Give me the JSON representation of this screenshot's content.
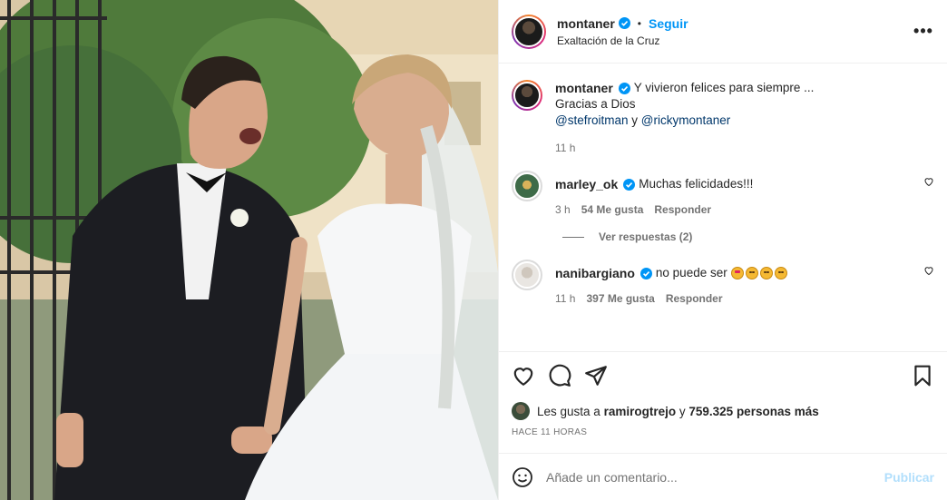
{
  "post": {
    "author": "montaner",
    "follow_label": "Seguir",
    "location": "Exaltación de la Cruz",
    "more_label": "•••"
  },
  "caption": {
    "author": "montaner",
    "line1": "Y vivieron felices para siempre ...",
    "line2": "Gracias a Dios",
    "mention1": "@stefroitman",
    "connector": "y",
    "mention2": "@rickymontaner",
    "time": "11 h"
  },
  "comments": [
    {
      "author": "marley_ok",
      "text": "Muchas felicidades!!!",
      "time": "3 h",
      "likes": "54 Me gusta",
      "reply_label": "Responder",
      "view_replies": "Ver respuestas (2)"
    },
    {
      "author": "nanibargiano",
      "text": "no puede ser",
      "emojis": [
        "smiling-face-with-heart-eyes",
        "pleading-face",
        "pleading-face",
        "pleading-face"
      ],
      "time": "11 h",
      "likes": "397 Me gusta",
      "reply_label": "Responder"
    }
  ],
  "likes": {
    "prefix": "Les gusta a",
    "user": "ramirogtrejo",
    "connector": "y",
    "count": "759.325 personas más"
  },
  "time_ago": "HACE 11 HORAS",
  "composer": {
    "placeholder": "Añade un comentario...",
    "publish_label": "Publicar"
  },
  "colors": {
    "link_blue": "#0095f6",
    "mention": "#00376b",
    "muted": "#737373",
    "publish_disabled": "#b2dffc"
  }
}
